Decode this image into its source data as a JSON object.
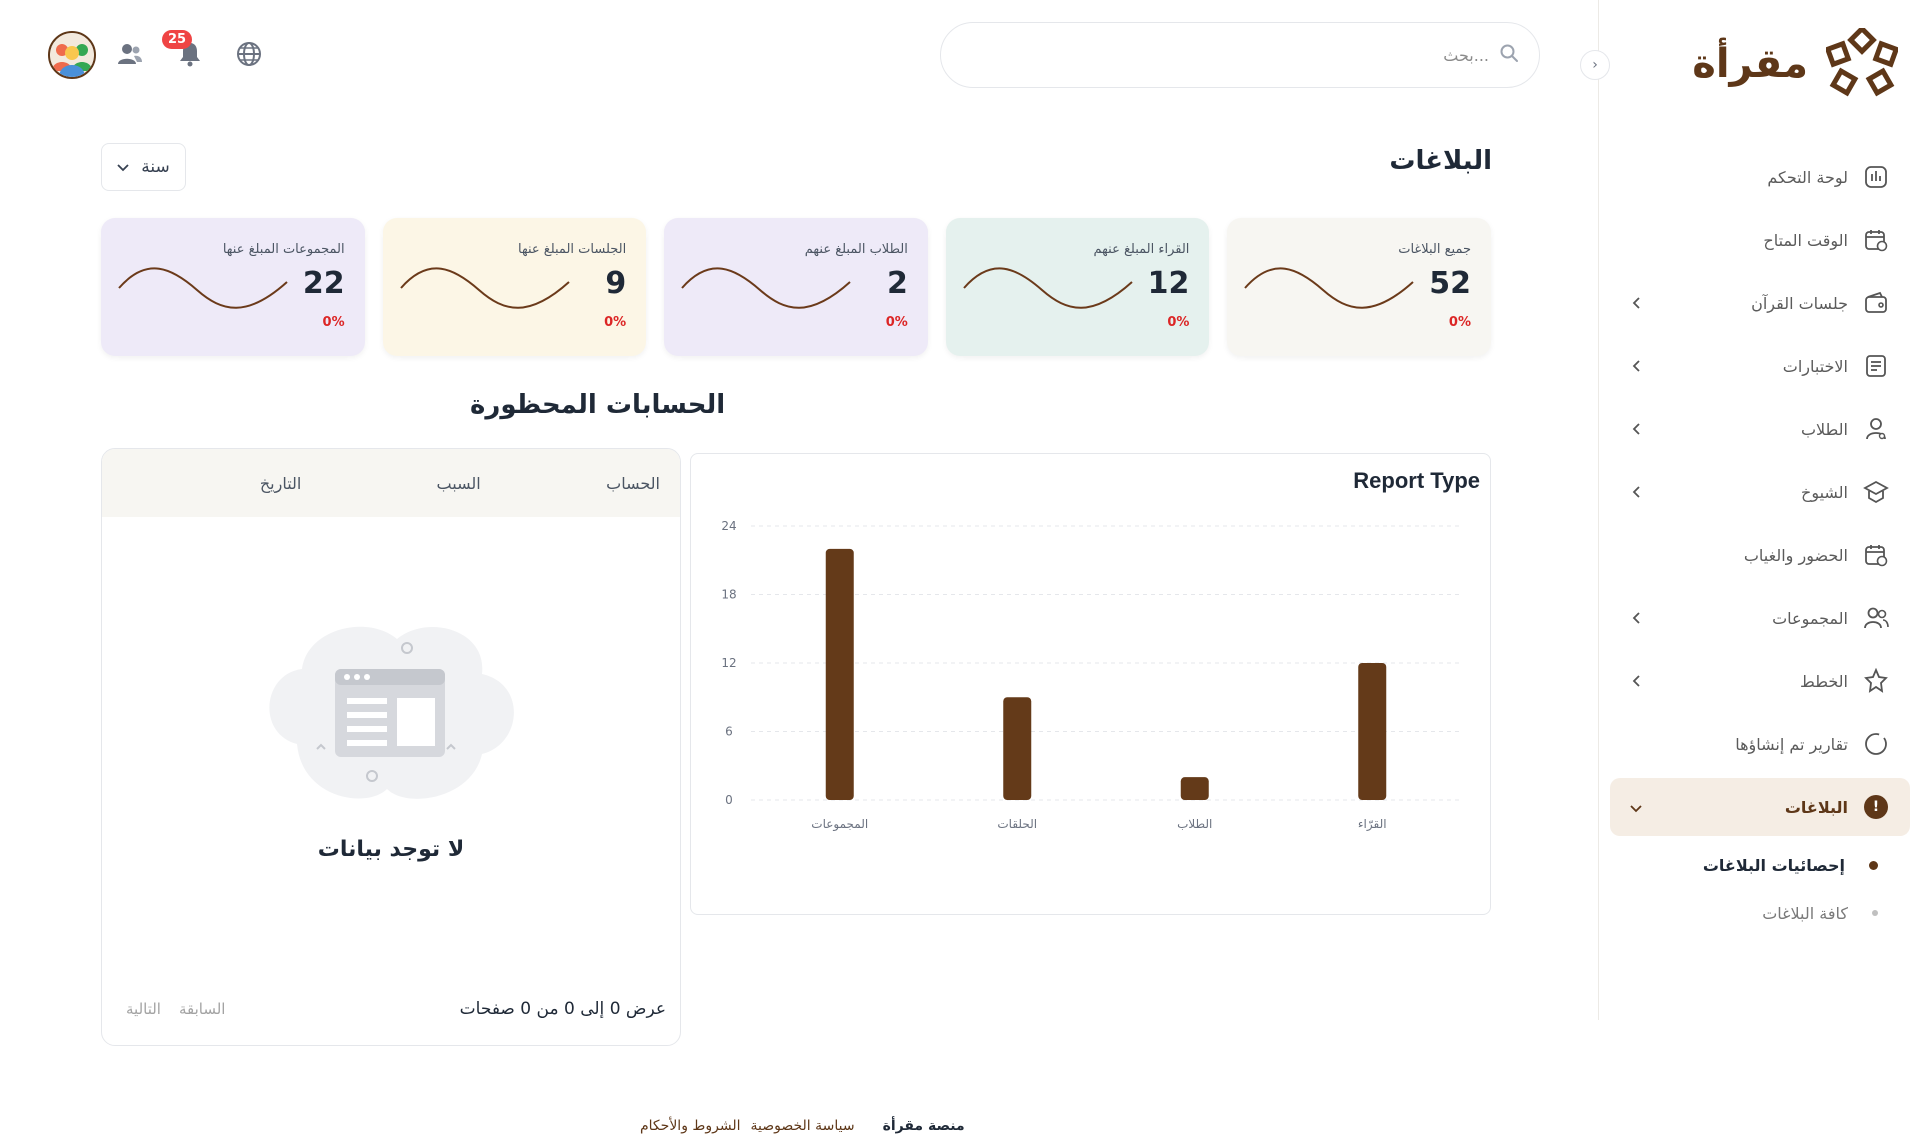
{
  "brand": {
    "name": "مقرأة",
    "color": "#5e3718"
  },
  "search": {
    "placeholder": "بحث..."
  },
  "topbar": {
    "notifications_count": "25"
  },
  "sidebar": {
    "items": [
      {
        "label": "لوحة التحكم",
        "icon": "dashboard-icon",
        "chevron": false
      },
      {
        "label": "الوقت المتاح",
        "icon": "calendar-clock-icon",
        "chevron": false
      },
      {
        "label": "جلسات القرآن",
        "icon": "wallet-icon",
        "chevron": true
      },
      {
        "label": "الاختبارات",
        "icon": "document-icon",
        "chevron": true
      },
      {
        "label": "الطلاب",
        "icon": "user-icon",
        "chevron": true
      },
      {
        "label": "الشيوخ",
        "icon": "graduation-cap-icon",
        "chevron": true
      },
      {
        "label": "الحضور والغياب",
        "icon": "calendar-check-icon",
        "chevron": false
      },
      {
        "label": "المجموعات",
        "icon": "users-icon",
        "chevron": true
      },
      {
        "label": "الخطط",
        "icon": "badge-star-icon",
        "chevron": true
      },
      {
        "label": "تقارير تم إنشاؤها",
        "icon": "circle-icon",
        "chevron": false
      },
      {
        "label": "البلاغات",
        "icon": "alert-icon",
        "chevron": true,
        "active": true
      }
    ],
    "subitems": [
      {
        "label": "إحصائيات البلاغات",
        "active": true
      },
      {
        "label": "كافة البلاغات",
        "active": false
      }
    ]
  },
  "page": {
    "title": "البلاغات",
    "period": "سنة"
  },
  "cards": [
    {
      "title": "جميع البلاغات",
      "value": "52",
      "change": "0%",
      "bg": "#f7f6f2"
    },
    {
      "title": "القراء المبلغ عنهم",
      "value": "12",
      "change": "0%",
      "bg": "#e5f1ee"
    },
    {
      "title": "الطلاب المبلغ عنهم",
      "value": "2",
      "change": "0%",
      "bg": "#eeeaf8"
    },
    {
      "title": "الجلسات المبلغ عنها",
      "value": "9",
      "change": "0%",
      "bg": "#fcf6e6"
    },
    {
      "title": "المجموعات المبلغ عنها",
      "value": "22",
      "change": "0%",
      "bg": "#eeeaf8"
    }
  ],
  "chart_data": {
    "type": "bar",
    "title": "Report Type",
    "categories": [
      "القرّاء",
      "الطلاب",
      "الحلقات",
      "المجموعات"
    ],
    "values": [
      12,
      2,
      9,
      22
    ],
    "ylim": [
      0,
      24
    ],
    "yticks": [
      "0",
      "6",
      "12",
      "18",
      "24"
    ],
    "grid": true,
    "color": "#643a19"
  },
  "banned": {
    "title": "الحسابات المحظورة",
    "columns": [
      "الحساب",
      "السبب",
      "التاريخ"
    ],
    "empty_text": "لا توجد بيانات",
    "pagination_info": "عرض 0 إلى 0 من 0 صفحات",
    "prev_label": "السابقة",
    "next_label": "التالية"
  },
  "footer": {
    "brand": "منصة مقرأة",
    "privacy": "سياسة الخصوصية",
    "terms": "الشروط والأحكام"
  }
}
